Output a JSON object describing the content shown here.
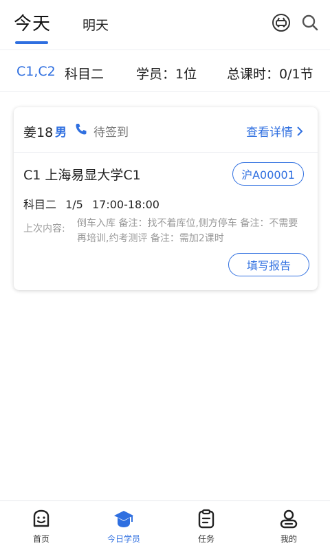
{
  "header": {
    "tab_today": "今天",
    "tab_tomorrow": "明天",
    "icons": [
      "car-service-icon",
      "search-icon"
    ]
  },
  "summary": {
    "license": "C1,C2",
    "subject": "科目二",
    "students": "学员：1位",
    "hours": "总课时：0/1节"
  },
  "card": {
    "student_name": "姜18",
    "gender": "男",
    "status": "待签到",
    "detail_link": "查看详情",
    "school": "C1 上海易显大学C1",
    "plate": "沪A00001",
    "subject": "科目二",
    "progress": "1/5",
    "time": "17:00-18:00",
    "last_label": "上次内容:",
    "last_content": "倒车入库 备注：找不着库位,侧方停车 备注：不需要再培训,约考测评 备注：需加2课时",
    "report_button": "填写报告"
  },
  "bottom_nav": {
    "items": [
      {
        "label": "首页",
        "icon": "home-face-icon"
      },
      {
        "label": "今日学员",
        "icon": "graduation-cap-icon",
        "active": true
      },
      {
        "label": "任务",
        "icon": "clipboard-icon"
      },
      {
        "label": "我的",
        "icon": "profile-icon"
      }
    ]
  },
  "colors": {
    "accent": "#2f6fe0",
    "muted_text": "#999999"
  }
}
